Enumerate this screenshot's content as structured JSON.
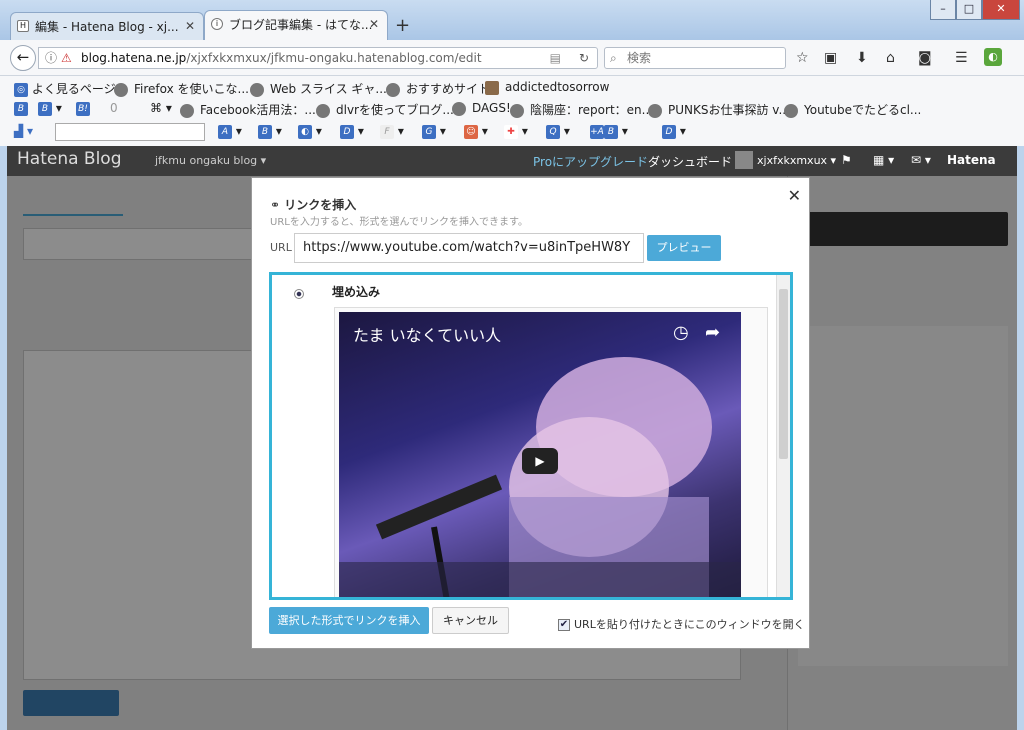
{
  "browser": {
    "tabs": [
      {
        "title": "編集 - Hatena Blog - xj...",
        "favicon": "H"
      },
      {
        "title": "ブログ記事編集 - はてな...",
        "favicon": "i"
      }
    ],
    "new_tab": "+",
    "window_controls": [
      "–",
      "□",
      "✕"
    ],
    "url_host": "blog.hatena.ne.jp",
    "url_path": "/xjxfxkxmxux/jfkmu-ongaku.hatenablog.com/edit",
    "search_placeholder": "検索",
    "bookmarks": [
      "よく見るページ",
      "Firefox を使いこな...",
      "Web スライス ギャ...",
      "おすすめサイト",
      "addictedtosorrow"
    ],
    "bookmarks2": [
      "Facebook活用法：...",
      "dlvrを使ってブログ...",
      "DAGS!",
      "陰陽座：report：en...",
      "PUNKSお仕事探訪 v...",
      "Youtubeでたどるcl..."
    ],
    "bookmarks2_prefix": [
      "B",
      "B",
      "B!",
      "0"
    ]
  },
  "hatena": {
    "logo": "Hatena Blog",
    "blog_name": "jfkmu ongaku blog ▾",
    "upgrade": "Proにアップグレード",
    "dashboard": "ダッシュボード",
    "user": "xjxfxkxmxux ▾",
    "brand": "Hatena"
  },
  "modal": {
    "title": "リンクを挿入",
    "subtitle": "URLを入力すると、形式を選んでリンクを挿入できます。",
    "url_label": "URL",
    "url_value": "https://www.youtube.com/watch?v=u8inTpeHW8Y",
    "preview_button": "プレビュー",
    "close": "✕",
    "option_label": "埋め込み",
    "video_title": "たま いなくていい人",
    "insert_button": "選択した形式でリンクを挿入",
    "cancel_button": "キャンセル",
    "checkbox_label": "URLを貼り付けたときにこのウィンドウを開く",
    "checkbox_checked": "✔"
  }
}
